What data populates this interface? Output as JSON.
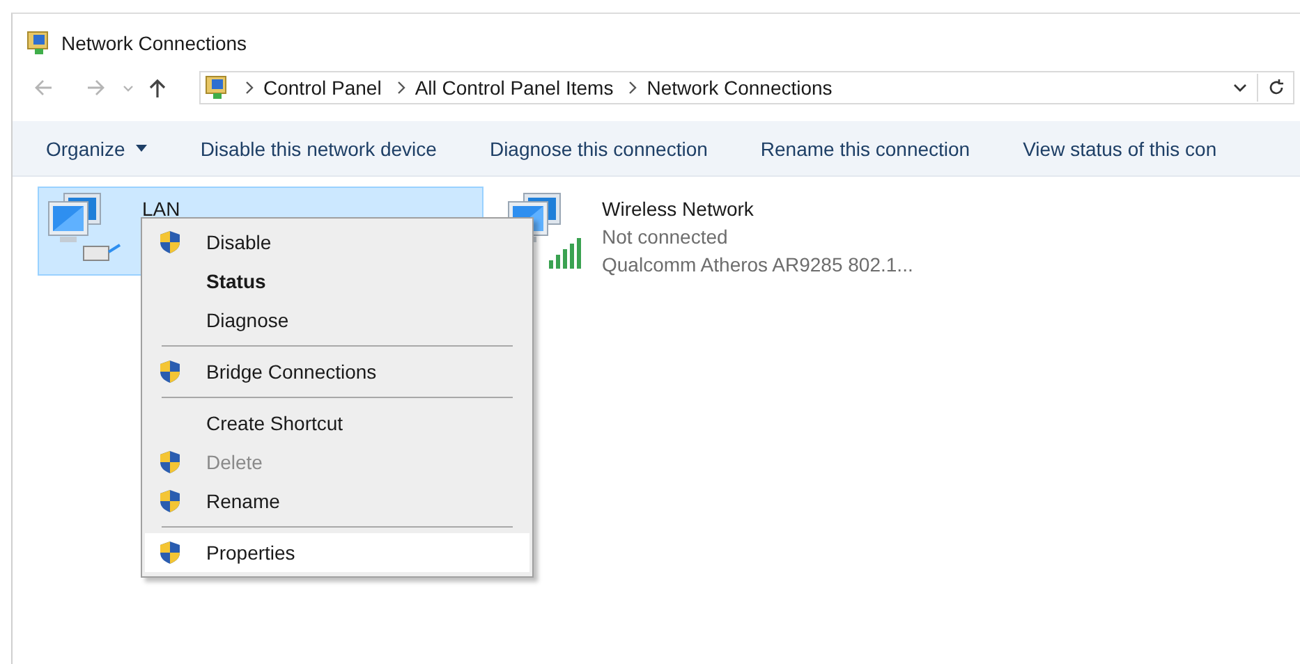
{
  "window": {
    "title": "Network Connections"
  },
  "address_bar": {
    "crumbs": [
      "Control Panel",
      "All Control Panel Items",
      "Network Connections"
    ]
  },
  "toolbar": {
    "items": [
      {
        "label": "Organize",
        "kind": "menu"
      },
      {
        "label": "Disable this network device",
        "kind": "command"
      },
      {
        "label": "Diagnose this connection",
        "kind": "command"
      },
      {
        "label": "Rename this connection",
        "kind": "command"
      },
      {
        "label": "View status of this con",
        "kind": "command"
      }
    ]
  },
  "connections": [
    {
      "name": "LAN",
      "kind": "wired",
      "selected": true
    },
    {
      "name": "Wireless Network",
      "kind": "wireless",
      "selected": false,
      "lines": [
        "Not connected",
        "Qualcomm Atheros AR9285 802.1..."
      ]
    }
  ],
  "context_menu": {
    "groups": [
      [
        {
          "label": "Disable",
          "shield": true,
          "default": false,
          "disabled": false,
          "selected": false
        },
        {
          "label": "Status",
          "shield": false,
          "default": true,
          "disabled": false,
          "selected": false
        },
        {
          "label": "Diagnose",
          "shield": false,
          "default": false,
          "disabled": false,
          "selected": false
        }
      ],
      [
        {
          "label": "Bridge Connections",
          "shield": true,
          "default": false,
          "disabled": false,
          "selected": false
        }
      ],
      [
        {
          "label": "Create Shortcut",
          "shield": false,
          "default": false,
          "disabled": false,
          "selected": false
        },
        {
          "label": "Delete",
          "shield": true,
          "default": false,
          "disabled": true,
          "selected": false
        },
        {
          "label": "Rename",
          "shield": true,
          "default": false,
          "disabled": false,
          "selected": false
        }
      ],
      [
        {
          "label": "Properties",
          "shield": true,
          "default": false,
          "disabled": false,
          "selected": true
        }
      ]
    ]
  }
}
